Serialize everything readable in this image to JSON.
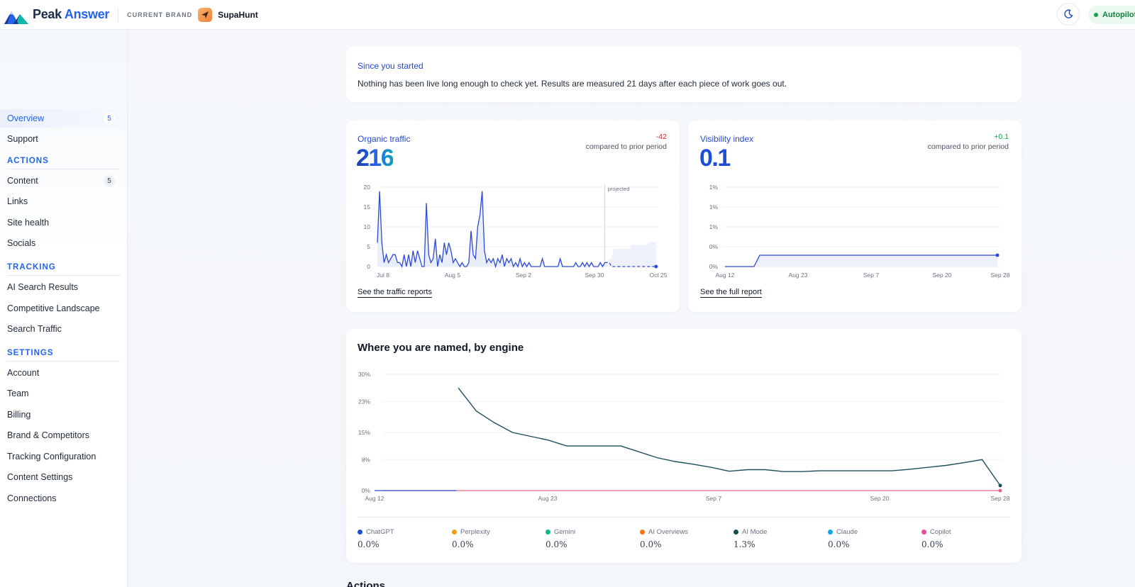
{
  "header": {
    "logo_peak": "Peak",
    "logo_answer": "Answer",
    "brand_label": "CURRENT BRAND",
    "brand_name": "SupaHunt",
    "autopilot_label": "Autopilot on",
    "icons": [
      "logo-mountain-icon",
      "paper-plane-icon",
      "moon-icon"
    ]
  },
  "sidebar": {
    "top_items": [
      {
        "label": "Overview",
        "badge": "5",
        "active": true
      },
      {
        "label": "Support",
        "badge": ""
      }
    ],
    "sections": [
      {
        "title": "ACTIONS",
        "items": [
          {
            "label": "Content",
            "badge": "5"
          },
          {
            "label": "Links",
            "badge": ""
          },
          {
            "label": "Site health",
            "badge": ""
          },
          {
            "label": "Socials",
            "badge": ""
          }
        ]
      },
      {
        "title": "TRACKING",
        "items": [
          {
            "label": "AI Search Results"
          },
          {
            "label": "Competitive Landscape"
          },
          {
            "label": "Search Traffic"
          }
        ]
      },
      {
        "title": "SETTINGS",
        "items": [
          {
            "label": "Account"
          },
          {
            "label": "Team"
          },
          {
            "label": "Billing"
          },
          {
            "label": "Brand & Competitors"
          },
          {
            "label": "Tracking Configuration"
          },
          {
            "label": "Content Settings"
          },
          {
            "label": "Connections"
          }
        ]
      }
    ]
  },
  "since": {
    "title": "Since you started",
    "text": "Nothing has been live long enough to check yet. Results are measured 21 days after each piece of work goes out."
  },
  "organic": {
    "title": "Organic traffic",
    "value": "216",
    "delta": "-42",
    "delta_caption": "compared to prior period",
    "link": "See the traffic reports",
    "projected_label": "projected"
  },
  "visibility": {
    "title": "Visibility index",
    "value": "0.1",
    "delta": "+0.1",
    "delta_caption": "compared to prior period",
    "link": "See the full report"
  },
  "engines": {
    "title": "Where you are named, by engine",
    "legend": [
      {
        "name": "ChatGPT",
        "value": "0.0%",
        "color": "#1d4ed8"
      },
      {
        "name": "Perplexity",
        "value": "0.0%",
        "color": "#f59e0b"
      },
      {
        "name": "Gemini",
        "value": "0.0%",
        "color": "#10b981"
      },
      {
        "name": "AI Overviews",
        "value": "0.0%",
        "color": "#f97316"
      },
      {
        "name": "AI Mode",
        "value": "1.3%",
        "color": "#134e4a"
      },
      {
        "name": "Claude",
        "value": "0.0%",
        "color": "#0ea5e9"
      },
      {
        "name": "Copilot",
        "value": "0.0%",
        "color": "#ec4899"
      }
    ]
  },
  "actions_heading": "Actions",
  "chart_data": [
    {
      "type": "line",
      "title": "Organic traffic",
      "x_ticks": [
        "Jul 8",
        "Aug 5",
        "Sep 2",
        "Sep 30",
        "Oct 25"
      ],
      "y_ticks": [
        "0",
        "5",
        "10",
        "15",
        "20"
      ],
      "ylim": [
        0,
        20
      ],
      "annotation": "projected",
      "series": [
        {
          "values": [
            6,
            19,
            6,
            1,
            3,
            1,
            2,
            3,
            3,
            1,
            1,
            0,
            3,
            0,
            3,
            0,
            4,
            1,
            4,
            2,
            0,
            0,
            16,
            3,
            1,
            2,
            7,
            0,
            3,
            1,
            6,
            3,
            6,
            4,
            1,
            2,
            1,
            0,
            1,
            0,
            0,
            1,
            9,
            3,
            2,
            10,
            13,
            19,
            4,
            1,
            2,
            1,
            2,
            0,
            2,
            1,
            3,
            0,
            2,
            1,
            2,
            0,
            1,
            0,
            2,
            0,
            1,
            0,
            1,
            0,
            0,
            0,
            0,
            0,
            2,
            0,
            0,
            0,
            0,
            0,
            0,
            0,
            2,
            0,
            0,
            0,
            0,
            0,
            0,
            1,
            0,
            0,
            1,
            0,
            1,
            0,
            1,
            0,
            0,
            0,
            1,
            0,
            1
          ]
        },
        {
          "name": "projected",
          "values": [
            1,
            1,
            1,
            0,
            0,
            0,
            0,
            0,
            0,
            0,
            0,
            0,
            0,
            0,
            0,
            0,
            0,
            0,
            0,
            0,
            0,
            0,
            0,
            0
          ]
        }
      ]
    },
    {
      "type": "line",
      "title": "Visibility index",
      "x_ticks": [
        "Aug 12",
        "Aug 23",
        "Sep 7",
        "Sep 20",
        "Sep 28"
      ],
      "y_ticks": [
        "0%",
        "0%",
        "1%",
        "1%",
        "1%"
      ],
      "series": [
        {
          "values": [
            0,
            0,
            0,
            0,
            0,
            0,
            0.1,
            0.1,
            0.1,
            0.1,
            0.1,
            0.1,
            0.1,
            0.1,
            0.1,
            0.1,
            0.1,
            0.1,
            0.1,
            0.1,
            0.1,
            0.1,
            0.1,
            0.1,
            0.1,
            0.1,
            0.1,
            0.1,
            0.1,
            0.1,
            0.1,
            0.1,
            0.1,
            0.1,
            0.1,
            0.1,
            0.1,
            0.1,
            0.1,
            0.1,
            0.1,
            0.1,
            0.1,
            0.1,
            0.1,
            0.1,
            0.1,
            0.1
          ]
        }
      ]
    },
    {
      "type": "line",
      "title": "Where you are named, by engine",
      "x_ticks": [
        "Aug 12",
        "Aug 23",
        "Sep 7",
        "Sep 20",
        "Sep 28"
      ],
      "y_ticks": [
        "0%",
        "8%",
        "15%",
        "23%",
        "30%"
      ],
      "ylim": [
        0,
        30
      ],
      "series": [
        {
          "name": "AI Mode",
          "values": [
            26.5,
            20.5,
            17.5,
            15,
            14,
            13,
            11.5,
            11.5,
            11.5,
            11.5,
            10,
            8.5,
            7.5,
            6.8,
            6,
            5,
            5.4,
            5.4,
            4.9,
            4.9,
            5.1,
            5.1,
            5.1,
            5.1,
            5.1,
            5.5,
            6,
            6.5,
            7.2,
            8,
            1.3
          ]
        },
        {
          "name": "ChatGPT",
          "values": [
            0,
            0,
            0,
            0,
            0,
            0,
            0,
            0,
            0,
            0,
            0,
            0,
            0,
            0,
            0,
            0,
            0,
            0,
            0,
            0,
            0,
            0,
            0,
            0,
            0,
            0,
            0,
            0,
            0,
            0,
            0
          ]
        },
        {
          "name": "Copilot",
          "values": [
            0,
            0,
            0,
            0,
            0,
            0,
            0,
            0,
            0,
            0,
            0,
            0,
            0,
            0,
            0,
            0,
            0,
            0,
            0,
            0,
            0,
            0,
            0,
            0,
            0,
            0,
            0,
            0,
            0,
            0,
            0
          ]
        }
      ]
    }
  ]
}
